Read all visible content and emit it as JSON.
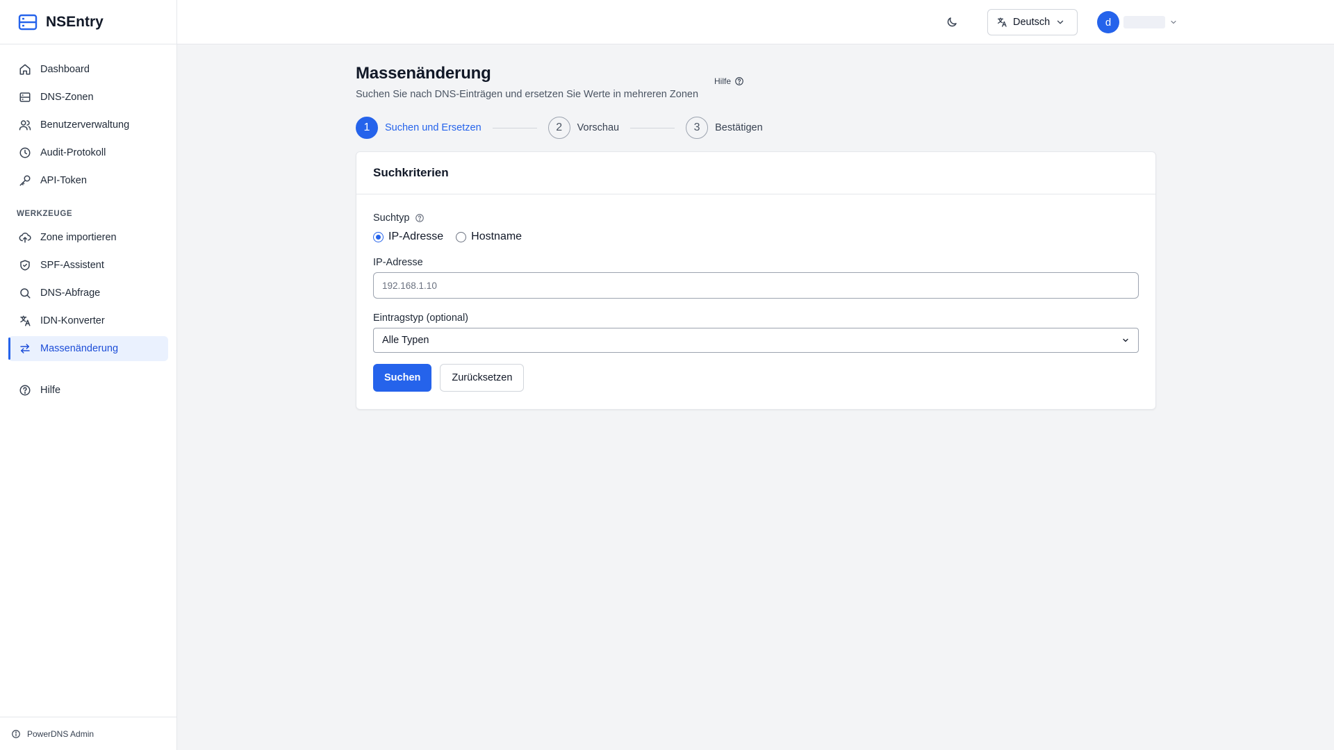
{
  "app": {
    "name": "NSEntry",
    "footer": "PowerDNS Admin"
  },
  "sidebar": {
    "items": [
      {
        "label": "Dashboard",
        "icon": "home-icon"
      },
      {
        "label": "DNS-Zonen",
        "icon": "server-icon"
      },
      {
        "label": "Benutzerverwaltung",
        "icon": "users-icon"
      },
      {
        "label": "Audit-Protokoll",
        "icon": "clock-icon"
      },
      {
        "label": "API-Token",
        "icon": "key-icon"
      }
    ],
    "tools_heading": "WERKZEUGE",
    "tools": [
      {
        "label": "Zone importieren",
        "icon": "cloud-upload-icon"
      },
      {
        "label": "SPF-Assistent",
        "icon": "shield-icon"
      },
      {
        "label": "DNS-Abfrage",
        "icon": "search-icon"
      },
      {
        "label": "IDN-Konverter",
        "icon": "translate-icon"
      },
      {
        "label": "Massenänderung",
        "icon": "arrows-swap-icon",
        "active": true
      }
    ],
    "help": {
      "label": "Hilfe",
      "icon": "help-circle-icon"
    }
  },
  "header": {
    "language": "Deutsch",
    "avatar_initial": "d",
    "username": ""
  },
  "page": {
    "title": "Massenänderung",
    "subtitle": "Suchen Sie nach DNS-Einträgen und ersetzen Sie Werte in mehreren Zonen",
    "help_link": "Hilfe"
  },
  "stepper": [
    {
      "number": "1",
      "label": "Suchen und Ersetzen",
      "active": true
    },
    {
      "number": "2",
      "label": "Vorschau",
      "active": false
    },
    {
      "number": "3",
      "label": "Bestätigen",
      "active": false
    }
  ],
  "card": {
    "title": "Suchkriterien",
    "search_type_label": "Suchtyp",
    "radio_options": [
      {
        "label": "IP-Adresse",
        "checked": true
      },
      {
        "label": "Hostname",
        "checked": false
      }
    ],
    "ip_label": "IP-Adresse",
    "ip_placeholder": "192.168.1.10",
    "ip_value": "",
    "record_type_label": "Eintragstyp (optional)",
    "record_type_value": "Alle Typen",
    "search_button": "Suchen",
    "reset_button": "Zurücksetzen"
  },
  "colors": {
    "accent": "#2563eb",
    "active_bg": "#eaf1fe",
    "background": "#f3f4f6"
  }
}
